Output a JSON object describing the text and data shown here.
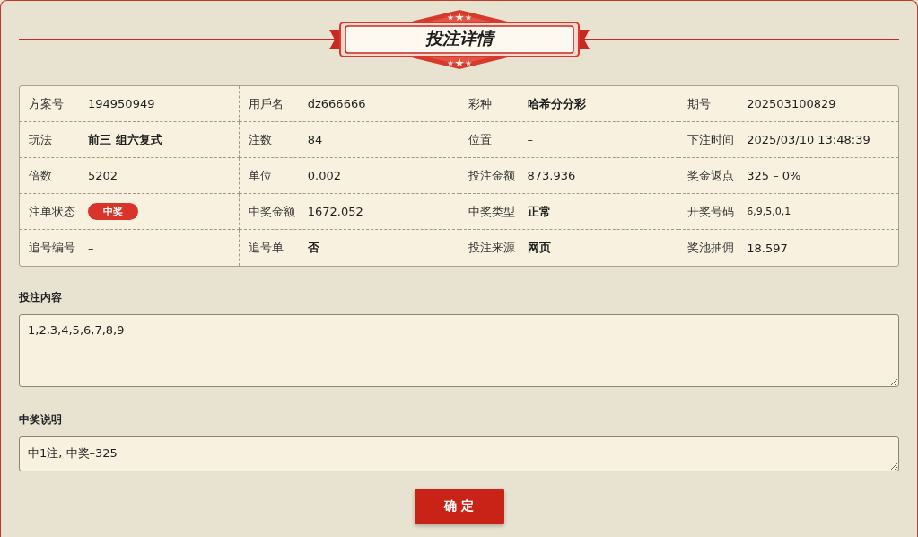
{
  "title": "投注详情",
  "details": [
    {
      "label": "方案号",
      "value": "194950949",
      "kind": "text",
      "bold": false
    },
    {
      "label": "用戶名",
      "value": "dz666666",
      "kind": "text",
      "bold": false
    },
    {
      "label": "彩种",
      "value": "哈希分分彩",
      "kind": "text",
      "bold": true
    },
    {
      "label": "期号",
      "value": "202503100829",
      "kind": "text",
      "bold": false
    },
    {
      "label": "玩法",
      "value": "前三 组六复式",
      "kind": "text",
      "bold": true
    },
    {
      "label": "注数",
      "value": "84",
      "kind": "text",
      "bold": false
    },
    {
      "label": "位置",
      "value": "–",
      "kind": "text",
      "bold": false
    },
    {
      "label": "下注时间",
      "value": "2025/03/10 13:48:39",
      "kind": "text",
      "bold": false
    },
    {
      "label": "倍数",
      "value": "5202",
      "kind": "text",
      "bold": false
    },
    {
      "label": "单位",
      "value": "0.002",
      "kind": "text",
      "bold": false
    },
    {
      "label": "投注金额",
      "value": "873.936",
      "kind": "text",
      "bold": false
    },
    {
      "label": "奖金返点",
      "value": "325 – 0%",
      "kind": "text",
      "bold": false
    },
    {
      "label": "注单状态",
      "value": "中奖",
      "kind": "badge",
      "bold": true
    },
    {
      "label": "中奖金额",
      "value": "1672.052",
      "kind": "text",
      "bold": false
    },
    {
      "label": "中奖类型",
      "value": "正常",
      "kind": "text",
      "bold": true
    },
    {
      "label": "开奖号码",
      "value": "6,9,5,0,1",
      "kind": "small",
      "bold": false
    },
    {
      "label": "追号编号",
      "value": "–",
      "kind": "text",
      "bold": false
    },
    {
      "label": "追号单",
      "value": "否",
      "kind": "text",
      "bold": true
    },
    {
      "label": "投注来源",
      "value": "网页",
      "kind": "text",
      "bold": true
    },
    {
      "label": "奖池抽佣",
      "value": "18.597",
      "kind": "text",
      "bold": false
    }
  ],
  "fields": [
    {
      "label": "投注内容",
      "value": "1,2,3,4,5,6,7,8,9",
      "kind": "multiline"
    },
    {
      "label": "中奖说明",
      "value": "中1注, 中奖–325",
      "kind": "single"
    }
  ],
  "button": "确 定"
}
